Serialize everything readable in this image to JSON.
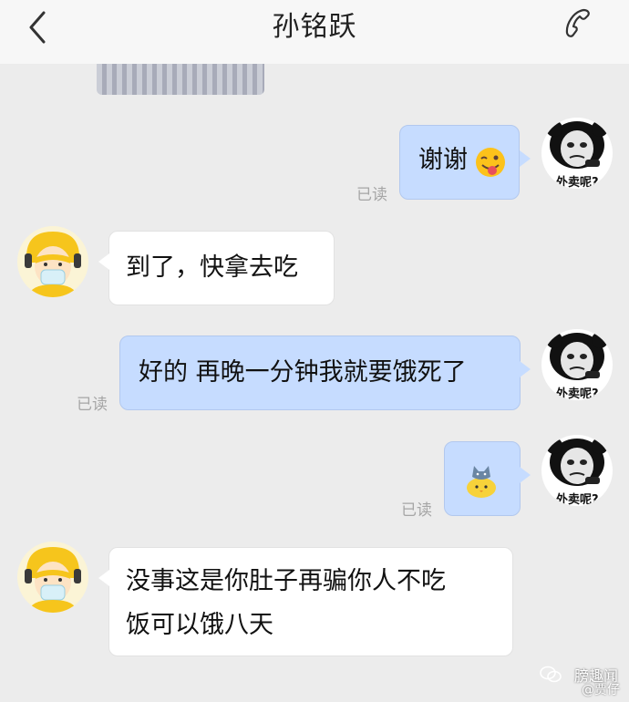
{
  "header": {
    "title": "孙铭跃"
  },
  "messages": {
    "m1": {
      "text": "谢谢",
      "emoji": "winking-tongue-emoji",
      "read": "已读"
    },
    "m2": {
      "text": "到了，快拿去吃"
    },
    "m3": {
      "text": "好的 再晚一分钟我就要饿死了",
      "read": "已读"
    },
    "m4": {
      "sticker": "cat-on-chick-sticker",
      "read": "已读"
    },
    "m5": {
      "line1": "没事这是你肚子再骗你人不吃",
      "line2": "饭可以饿八天"
    }
  },
  "avatars": {
    "self_caption": "外卖呢?"
  },
  "watermark": {
    "line1": "膀趣闻",
    "line2": "@贾仔"
  },
  "colors": {
    "out_bubble": "#c6dcff",
    "in_bubble": "#ffffff",
    "background": "#ececec"
  }
}
